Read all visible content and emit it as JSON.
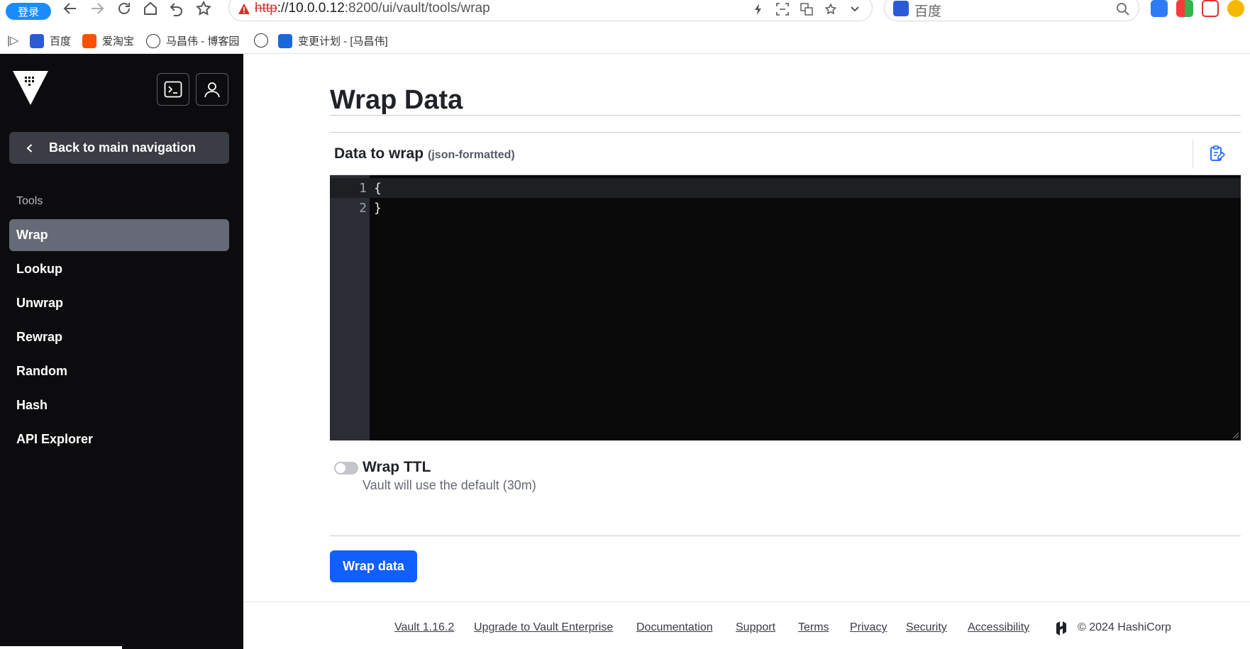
{
  "browser": {
    "login_label": "登录",
    "url_proto": "http",
    "url_host": "://10.0.0.12",
    "url_rest": ":8200/ui/vault/tools/wrap",
    "search_placeholder": "百度",
    "bookmarks": [
      {
        "label": "百度",
        "color": "#2a5bd7"
      },
      {
        "label": "爱淘宝",
        "color": "#ff5000"
      },
      {
        "label": "马昌伟 - 博客园",
        "color": "#333333"
      },
      {
        "label": "变更计划 - [马昌伟]",
        "color": "#1868db"
      }
    ]
  },
  "sidebar": {
    "back_label": "Back to main navigation",
    "section_label": "Tools",
    "items": [
      {
        "label": "Wrap",
        "active": true
      },
      {
        "label": "Lookup",
        "active": false
      },
      {
        "label": "Unwrap",
        "active": false
      },
      {
        "label": "Rewrap",
        "active": false
      },
      {
        "label": "Random",
        "active": false
      },
      {
        "label": "Hash",
        "active": false
      },
      {
        "label": "API Explorer",
        "active": false
      }
    ]
  },
  "main": {
    "title": "Wrap Data",
    "editor_label": "Data to wrap",
    "editor_sublabel": "(json-formatted)",
    "editor_lines": [
      {
        "num": "1",
        "code": "{"
      },
      {
        "num": "2",
        "code": "}"
      }
    ],
    "ttl_label": "Wrap TTL",
    "ttl_help": "Vault will use the default (30m)",
    "ttl_enabled": false,
    "submit_label": "Wrap data"
  },
  "footer": {
    "links": [
      "Vault 1.16.2",
      "Upgrade to Vault Enterprise",
      "Documentation",
      "Support",
      "Terms",
      "Privacy",
      "Security",
      "Accessibility"
    ],
    "copyright": "© 2024 HashiCorp"
  },
  "colors": {
    "sidebar_bg": "#0c0c0e",
    "active_nav": "#656a76",
    "primary_button": "#1060ff",
    "editor_bg": "#0a0a0a"
  }
}
